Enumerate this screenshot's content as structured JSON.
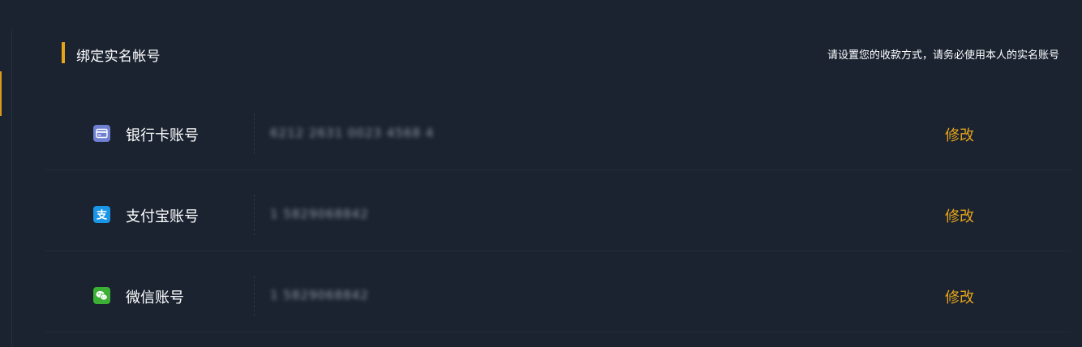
{
  "header": {
    "title": "绑定实名帐号",
    "hint": "请设置您的收款方式，请务必使用本人的实名账号"
  },
  "accounts": [
    {
      "icon": "bank-card-icon",
      "label": "银行卡账号",
      "value": "6212 2631 0023 4568 4",
      "action": "修改",
      "icon_color": "#6f7fd1"
    },
    {
      "icon": "alipay-icon",
      "label": "支付宝账号",
      "value": "1 5829068842",
      "action": "修改",
      "icon_color": "#1a96e6"
    },
    {
      "icon": "wechat-icon",
      "label": "微信账号",
      "value": "1 5829068842",
      "action": "修改",
      "icon_color": "#3cb034"
    }
  ],
  "colors": {
    "background": "#1b2331",
    "accent": "#e6a419",
    "text": "#ffffff"
  }
}
